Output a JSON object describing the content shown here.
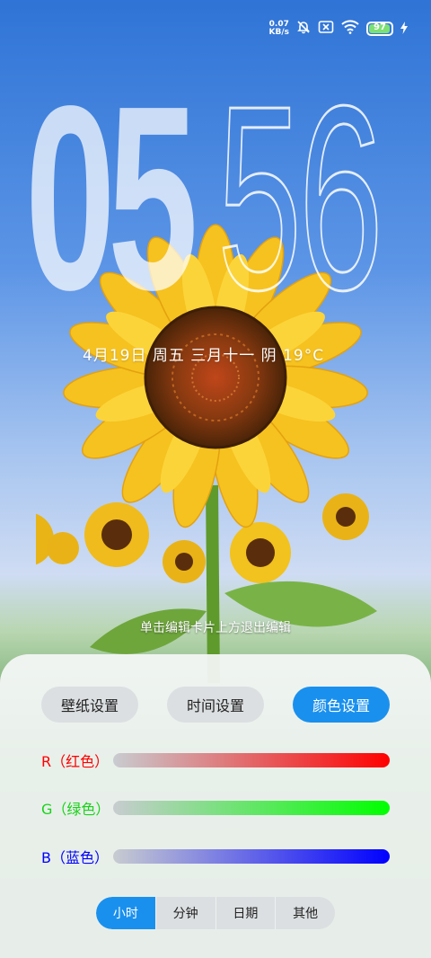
{
  "status_bar": {
    "net_speed_value": "0.07",
    "net_speed_unit": "KB/s",
    "battery_level": "97",
    "battery_fraction": 0.97
  },
  "clock": {
    "hours": "05",
    "minutes": "56"
  },
  "date_line": "4月19日  周五  三月十一  阴 19°C",
  "exit_hint": "单击编辑卡片上方退出编辑",
  "tabs": [
    {
      "label": "壁纸设置",
      "active": false
    },
    {
      "label": "时间设置",
      "active": false
    },
    {
      "label": "颜色设置",
      "active": true
    }
  ],
  "sliders": [
    {
      "label": "R（红色）",
      "color": "#ff0000",
      "value": 1.0
    },
    {
      "label": "G（绿色）",
      "color": "#00ff00",
      "value": 1.0
    },
    {
      "label": "B（蓝色）",
      "color": "#0000ff",
      "value": 1.0
    }
  ],
  "segments": [
    {
      "label": "小时",
      "active": true
    },
    {
      "label": "分钟",
      "active": false
    },
    {
      "label": "日期",
      "active": false
    },
    {
      "label": "其他",
      "active": false
    }
  ],
  "colors": {
    "accent": "#1a90ee",
    "pill_bg": "#dcdfe1",
    "battery_green": "#7de072"
  }
}
